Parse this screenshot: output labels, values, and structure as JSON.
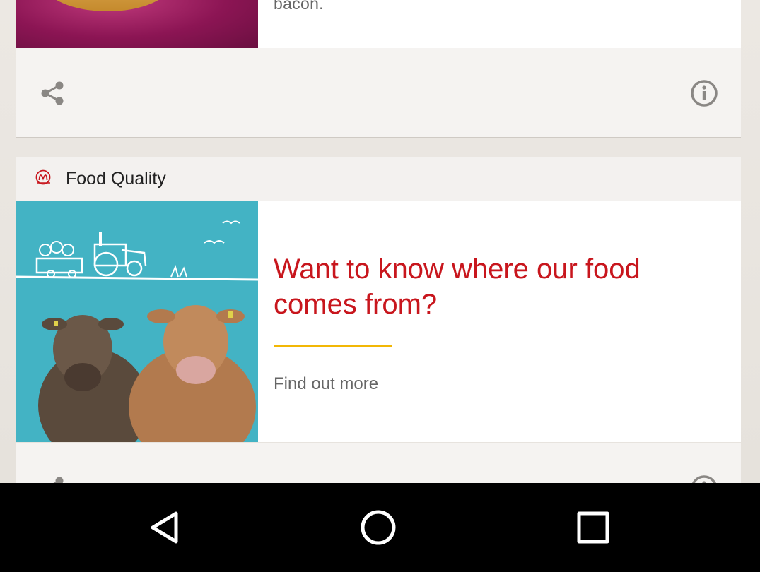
{
  "card1": {
    "text": "bacon."
  },
  "card2": {
    "category": "Food Quality",
    "title": "Want to know where our food comes from?",
    "cta": "Find out more"
  },
  "colors": {
    "title_red": "#c8161d",
    "accent_yellow": "#f2b705"
  },
  "icons": {
    "share": "share-icon",
    "info": "info-icon",
    "logo": "mcdonalds-logo-icon",
    "nav_back": "back-triangle-icon",
    "nav_home": "home-circle-icon",
    "nav_recents": "recents-square-icon"
  }
}
